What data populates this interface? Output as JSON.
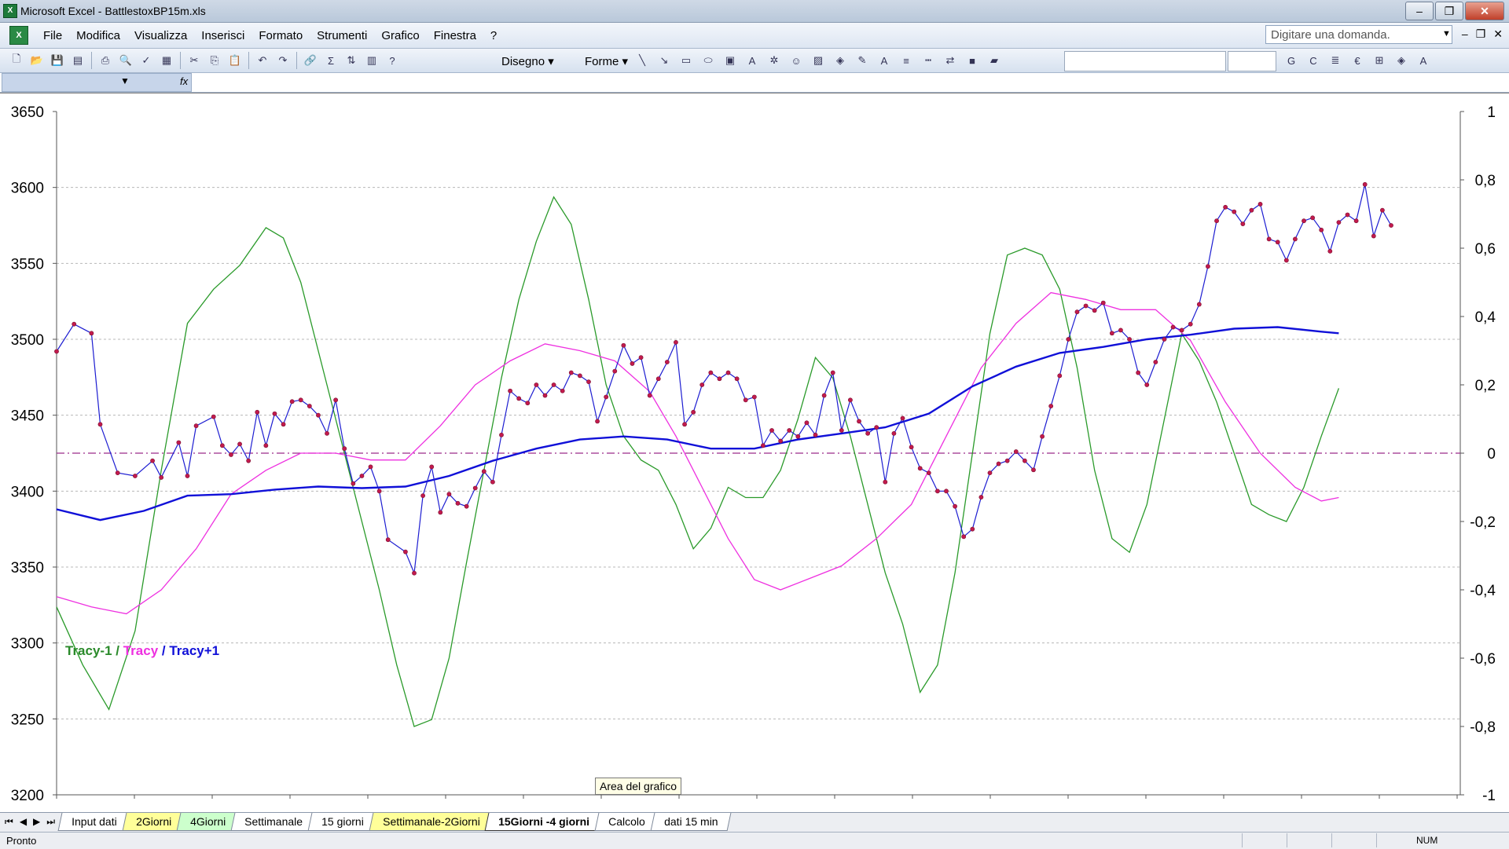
{
  "window": {
    "title": "Microsoft Excel - BattlestoxBP15m.xls",
    "app_icon": "excel-icon"
  },
  "window_buttons": {
    "minimize": "‒",
    "maximize": "❐",
    "close": "✕"
  },
  "menu": [
    "File",
    "Modifica",
    "Visualizza",
    "Inserisci",
    "Formato",
    "Strumenti",
    "Grafico",
    "Finestra",
    "?"
  ],
  "ask_box": {
    "placeholder": "Digitare una domanda."
  },
  "toolbar": {
    "disegno": "Disegno ▾",
    "forme": "Forme ▾"
  },
  "formula_bar": {
    "name_box": "",
    "fx": "fx"
  },
  "chart": {
    "legend": {
      "series1": "Tracy-1",
      "sep1": " / ",
      "series2": "Tracy",
      "sep2": " / ",
      "series3": "Tracy+1"
    },
    "tooltip": "Area del grafico",
    "colors": {
      "price": "#1d1dd1",
      "price_marker": "#c21a4d",
      "tracy_minus": "#2a9a2a",
      "tracy": "#ee30e0",
      "tracy_plus": "#1010d8",
      "zero_line": "#9a2a8a"
    }
  },
  "chart_data": {
    "type": "line",
    "y_left": {
      "min": 3200,
      "max": 3650,
      "ticks": [
        "3650",
        "3600",
        "3550",
        "3500",
        "3450",
        "3400",
        "3350",
        "3300",
        "3250",
        "3200"
      ]
    },
    "y_right": {
      "min": -1,
      "max": 1,
      "ticks": [
        "1",
        "0,8",
        "0,6",
        "0,4",
        "0,2",
        "0",
        "-0,2",
        "-0,4",
        "-0,6",
        "-0,8",
        "-1"
      ]
    },
    "x_count": 200,
    "grid": true,
    "series": [
      {
        "name": "Tracy-1",
        "axis": "right",
        "points": [
          [
            0,
            -0.45
          ],
          [
            6,
            -0.62
          ],
          [
            12,
            -0.75
          ],
          [
            18,
            -0.52
          ],
          [
            24,
            -0.05
          ],
          [
            30,
            0.38
          ],
          [
            36,
            0.48
          ],
          [
            42,
            0.55
          ],
          [
            48,
            0.66
          ],
          [
            52,
            0.63
          ],
          [
            56,
            0.5
          ],
          [
            62,
            0.2
          ],
          [
            68,
            -0.1
          ],
          [
            74,
            -0.4
          ],
          [
            78,
            -0.62
          ],
          [
            82,
            -0.8
          ],
          [
            86,
            -0.78
          ],
          [
            90,
            -0.6
          ],
          [
            94,
            -0.32
          ],
          [
            98,
            -0.05
          ],
          [
            102,
            0.22
          ],
          [
            106,
            0.45
          ],
          [
            110,
            0.62
          ],
          [
            114,
            0.75
          ],
          [
            118,
            0.67
          ],
          [
            122,
            0.45
          ],
          [
            126,
            0.2
          ],
          [
            130,
            0.05
          ],
          [
            134,
            -0.02
          ],
          [
            138,
            -0.05
          ],
          [
            142,
            -0.15
          ],
          [
            146,
            -0.28
          ],
          [
            150,
            -0.22
          ],
          [
            154,
            -0.1
          ],
          [
            158,
            -0.13
          ],
          [
            162,
            -0.13
          ],
          [
            166,
            -0.05
          ],
          [
            170,
            0.1
          ],
          [
            174,
            0.28
          ],
          [
            178,
            0.22
          ],
          [
            182,
            0.05
          ],
          [
            186,
            -0.15
          ],
          [
            190,
            -0.35
          ],
          [
            194,
            -0.5
          ],
          [
            198,
            -0.7
          ],
          [
            202,
            -0.62
          ],
          [
            206,
            -0.35
          ],
          [
            210,
            0.0
          ],
          [
            214,
            0.35
          ],
          [
            218,
            0.58
          ],
          [
            222,
            0.6
          ],
          [
            226,
            0.58
          ],
          [
            230,
            0.48
          ],
          [
            234,
            0.25
          ],
          [
            238,
            -0.05
          ],
          [
            242,
            -0.25
          ],
          [
            246,
            -0.29
          ],
          [
            250,
            -0.15
          ],
          [
            254,
            0.1
          ],
          [
            258,
            0.35
          ],
          [
            262,
            0.27
          ],
          [
            266,
            0.15
          ],
          [
            270,
            0.0
          ],
          [
            274,
            -0.15
          ],
          [
            278,
            -0.18
          ],
          [
            282,
            -0.2
          ],
          [
            286,
            -0.1
          ],
          [
            290,
            0.05
          ],
          [
            294,
            0.19
          ]
        ]
      },
      {
        "name": "Tracy",
        "axis": "right",
        "points": [
          [
            0,
            -0.42
          ],
          [
            8,
            -0.45
          ],
          [
            16,
            -0.47
          ],
          [
            24,
            -0.4
          ],
          [
            32,
            -0.28
          ],
          [
            40,
            -0.12
          ],
          [
            48,
            -0.05
          ],
          [
            56,
            0.0
          ],
          [
            64,
            0.0
          ],
          [
            72,
            -0.02
          ],
          [
            80,
            -0.02
          ],
          [
            88,
            0.08
          ],
          [
            96,
            0.2
          ],
          [
            104,
            0.27
          ],
          [
            112,
            0.32
          ],
          [
            120,
            0.3
          ],
          [
            128,
            0.27
          ],
          [
            136,
            0.18
          ],
          [
            142,
            0.05
          ],
          [
            148,
            -0.1
          ],
          [
            154,
            -0.25
          ],
          [
            160,
            -0.37
          ],
          [
            166,
            -0.4
          ],
          [
            172,
            -0.37
          ],
          [
            180,
            -0.33
          ],
          [
            188,
            -0.25
          ],
          [
            196,
            -0.15
          ],
          [
            204,
            0.05
          ],
          [
            212,
            0.25
          ],
          [
            220,
            0.38
          ],
          [
            228,
            0.47
          ],
          [
            236,
            0.45
          ],
          [
            244,
            0.42
          ],
          [
            252,
            0.42
          ],
          [
            260,
            0.33
          ],
          [
            268,
            0.15
          ],
          [
            276,
            0.0
          ],
          [
            284,
            -0.1
          ],
          [
            290,
            -0.14
          ],
          [
            294,
            -0.13
          ]
        ]
      },
      {
        "name": "Tracy+1",
        "axis": "left",
        "points": [
          [
            0,
            3388
          ],
          [
            10,
            3381
          ],
          [
            20,
            3387
          ],
          [
            30,
            3397
          ],
          [
            40,
            3398
          ],
          [
            50,
            3401
          ],
          [
            60,
            3403
          ],
          [
            70,
            3402
          ],
          [
            80,
            3403
          ],
          [
            90,
            3410
          ],
          [
            100,
            3420
          ],
          [
            110,
            3428
          ],
          [
            120,
            3434
          ],
          [
            130,
            3436
          ],
          [
            140,
            3434
          ],
          [
            150,
            3428
          ],
          [
            160,
            3428
          ],
          [
            170,
            3434
          ],
          [
            180,
            3438
          ],
          [
            190,
            3442
          ],
          [
            200,
            3451
          ],
          [
            210,
            3469
          ],
          [
            220,
            3482
          ],
          [
            230,
            3491
          ],
          [
            240,
            3495
          ],
          [
            250,
            3500
          ],
          [
            260,
            3503
          ],
          [
            270,
            3507
          ],
          [
            280,
            3508
          ],
          [
            290,
            3505
          ],
          [
            294,
            3504
          ]
        ]
      },
      {
        "name": "Price",
        "axis": "left",
        "points": [
          [
            0,
            3492
          ],
          [
            4,
            3510
          ],
          [
            8,
            3504
          ],
          [
            10,
            3444
          ],
          [
            14,
            3412
          ],
          [
            18,
            3410
          ],
          [
            22,
            3420
          ],
          [
            24,
            3409
          ],
          [
            28,
            3432
          ],
          [
            30,
            3410
          ],
          [
            32,
            3443
          ],
          [
            36,
            3449
          ],
          [
            38,
            3430
          ],
          [
            40,
            3424
          ],
          [
            42,
            3431
          ],
          [
            44,
            3420
          ],
          [
            46,
            3452
          ],
          [
            48,
            3430
          ],
          [
            50,
            3451
          ],
          [
            52,
            3444
          ],
          [
            54,
            3459
          ],
          [
            56,
            3460
          ],
          [
            58,
            3456
          ],
          [
            60,
            3450
          ],
          [
            62,
            3438
          ],
          [
            64,
            3460
          ],
          [
            66,
            3428
          ],
          [
            68,
            3405
          ],
          [
            70,
            3410
          ],
          [
            72,
            3416
          ],
          [
            74,
            3400
          ],
          [
            76,
            3368
          ],
          [
            80,
            3360
          ],
          [
            82,
            3346
          ],
          [
            84,
            3397
          ],
          [
            86,
            3416
          ],
          [
            88,
            3386
          ],
          [
            90,
            3398
          ],
          [
            92,
            3392
          ],
          [
            94,
            3390
          ],
          [
            96,
            3402
          ],
          [
            98,
            3413
          ],
          [
            100,
            3406
          ],
          [
            102,
            3437
          ],
          [
            104,
            3466
          ],
          [
            106,
            3461
          ],
          [
            108,
            3458
          ],
          [
            110,
            3470
          ],
          [
            112,
            3463
          ],
          [
            114,
            3470
          ],
          [
            116,
            3466
          ],
          [
            118,
            3478
          ],
          [
            120,
            3476
          ],
          [
            122,
            3472
          ],
          [
            124,
            3446
          ],
          [
            126,
            3462
          ],
          [
            128,
            3479
          ],
          [
            130,
            3496
          ],
          [
            132,
            3484
          ],
          [
            134,
            3488
          ],
          [
            136,
            3463
          ],
          [
            138,
            3474
          ],
          [
            140,
            3485
          ],
          [
            142,
            3498
          ],
          [
            144,
            3444
          ],
          [
            146,
            3452
          ],
          [
            148,
            3470
          ],
          [
            150,
            3478
          ],
          [
            152,
            3474
          ],
          [
            154,
            3478
          ],
          [
            156,
            3474
          ],
          [
            158,
            3460
          ],
          [
            160,
            3462
          ],
          [
            162,
            3430
          ],
          [
            164,
            3440
          ],
          [
            166,
            3433
          ],
          [
            168,
            3440
          ],
          [
            170,
            3436
          ],
          [
            172,
            3445
          ],
          [
            174,
            3437
          ],
          [
            176,
            3463
          ],
          [
            178,
            3478
          ],
          [
            180,
            3440
          ],
          [
            182,
            3460
          ],
          [
            184,
            3446
          ],
          [
            186,
            3438
          ],
          [
            188,
            3442
          ],
          [
            190,
            3406
          ],
          [
            192,
            3438
          ],
          [
            194,
            3448
          ],
          [
            196,
            3429
          ],
          [
            198,
            3415
          ],
          [
            200,
            3412
          ],
          [
            202,
            3400
          ],
          [
            204,
            3400
          ],
          [
            206,
            3390
          ],
          [
            208,
            3370
          ],
          [
            210,
            3375
          ],
          [
            212,
            3396
          ],
          [
            214,
            3412
          ],
          [
            216,
            3418
          ],
          [
            218,
            3420
          ],
          [
            220,
            3426
          ],
          [
            222,
            3420
          ],
          [
            224,
            3414
          ],
          [
            226,
            3436
          ],
          [
            228,
            3456
          ],
          [
            230,
            3476
          ],
          [
            232,
            3500
          ],
          [
            234,
            3518
          ],
          [
            236,
            3522
          ],
          [
            238,
            3519
          ],
          [
            240,
            3524
          ],
          [
            242,
            3504
          ],
          [
            244,
            3506
          ],
          [
            246,
            3500
          ],
          [
            248,
            3478
          ],
          [
            250,
            3470
          ],
          [
            252,
            3485
          ],
          [
            254,
            3500
          ],
          [
            256,
            3508
          ],
          [
            258,
            3506
          ],
          [
            260,
            3510
          ],
          [
            262,
            3523
          ],
          [
            264,
            3548
          ],
          [
            266,
            3578
          ],
          [
            268,
            3587
          ],
          [
            270,
            3584
          ],
          [
            272,
            3576
          ],
          [
            274,
            3585
          ],
          [
            276,
            3589
          ],
          [
            278,
            3566
          ],
          [
            280,
            3564
          ],
          [
            282,
            3552
          ],
          [
            284,
            3566
          ],
          [
            286,
            3578
          ],
          [
            288,
            3580
          ],
          [
            290,
            3572
          ],
          [
            292,
            3558
          ],
          [
            294,
            3577
          ],
          [
            296,
            3582
          ],
          [
            298,
            3578
          ],
          [
            300,
            3602
          ],
          [
            302,
            3568
          ],
          [
            304,
            3585
          ],
          [
            306,
            3575
          ]
        ]
      }
    ]
  },
  "sheet_tabs": [
    {
      "label": "Input dati",
      "style": "white"
    },
    {
      "label": "2Giorni",
      "style": "yellow"
    },
    {
      "label": "4Giorni",
      "style": "green"
    },
    {
      "label": "Settimanale",
      "style": "white"
    },
    {
      "label": "15 giorni",
      "style": "white"
    },
    {
      "label": "Settimanale-2Giorni",
      "style": "yellow"
    },
    {
      "label": "15Giorni -4 giorni",
      "style": "active"
    },
    {
      "label": "Calcolo",
      "style": "white"
    },
    {
      "label": "dati 15 min",
      "style": "white"
    }
  ],
  "tab_nav": [
    "⏮",
    "◀",
    "▶",
    "⏭"
  ],
  "status": {
    "left": "Pronto",
    "num": "NUM"
  }
}
